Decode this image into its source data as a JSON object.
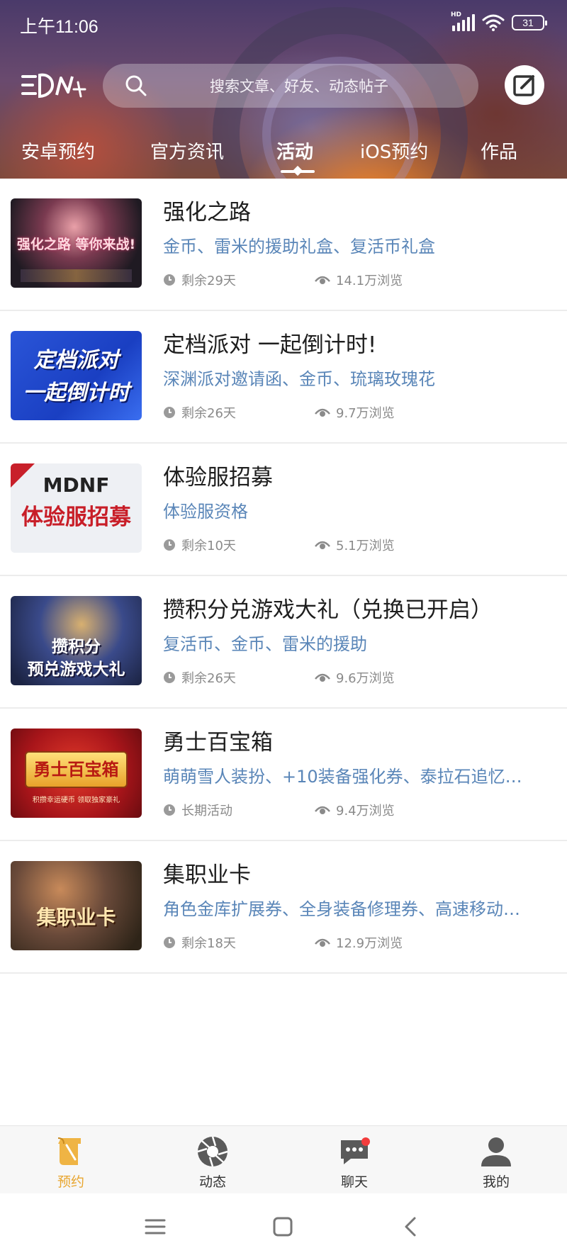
{
  "status_bar": {
    "time": "上午11:06",
    "network_label": "HD",
    "battery": "31"
  },
  "header": {
    "search_placeholder": "搜索文章、好友、动态帖子",
    "tabs": [
      {
        "label": "安卓预约",
        "active": false
      },
      {
        "label": "官方资讯",
        "active": false
      },
      {
        "label": "活动",
        "active": true
      },
      {
        "label": "iOS预约",
        "active": false
      },
      {
        "label": "作品",
        "active": false
      }
    ]
  },
  "activities": [
    {
      "thumb_text": "强化之路 等你来战!",
      "title": "强化之路",
      "rewards": "金币、雷米的援助礼盒、复活币礼盒",
      "time_left": "剩余29天",
      "views": "14.1万浏览"
    },
    {
      "thumb_text_line1": "定档派对",
      "thumb_text_line2": "一起倒计时",
      "title": "定档派对 一起倒计时!",
      "rewards": "深渊派对邀请函、金币、琉璃玫瑰花",
      "time_left": "剩余26天",
      "views": "9.7万浏览"
    },
    {
      "thumb_text_line1": "MDNF",
      "thumb_text_line2": "体验服招募",
      "title": "体验服招募",
      "rewards": "体验服资格",
      "time_left": "剩余10天",
      "views": "5.1万浏览"
    },
    {
      "thumb_text_line1": "攒积分",
      "thumb_text_line2": "预兑游戏大礼",
      "title": "攒积分兑游戏大礼（兑换已开启）",
      "rewards": "复活币、金币、雷米的援助",
      "time_left": "剩余26天",
      "views": "9.6万浏览"
    },
    {
      "thumb_text": "勇士百宝箱",
      "thumb_sub": "积攒幸运硬币 领取独家豪礼",
      "title": "勇士百宝箱",
      "rewards": "萌萌雪人装扮、+10装备强化券、泰拉石追忆…",
      "time_left": "长期活动",
      "views": "9.4万浏览"
    },
    {
      "thumb_text": "集职业卡",
      "title": "集职业卡",
      "rewards": "角色金库扩展券、全身装备修理券、高速移动…",
      "time_left": "剩余18天",
      "views": "12.9万浏览"
    }
  ],
  "bottom_nav": [
    {
      "label": "预约",
      "icon": "scroll-icon",
      "active": true
    },
    {
      "label": "动态",
      "icon": "aperture-icon",
      "active": false
    },
    {
      "label": "聊天",
      "icon": "chat-icon",
      "active": false,
      "badge": true
    },
    {
      "label": "我的",
      "icon": "person-icon",
      "active": false
    }
  ],
  "colors": {
    "accent": "#e8a52e",
    "reward_text": "#5a86b8",
    "meta_text": "#8a8a8a",
    "badge": "#f23c3c"
  }
}
